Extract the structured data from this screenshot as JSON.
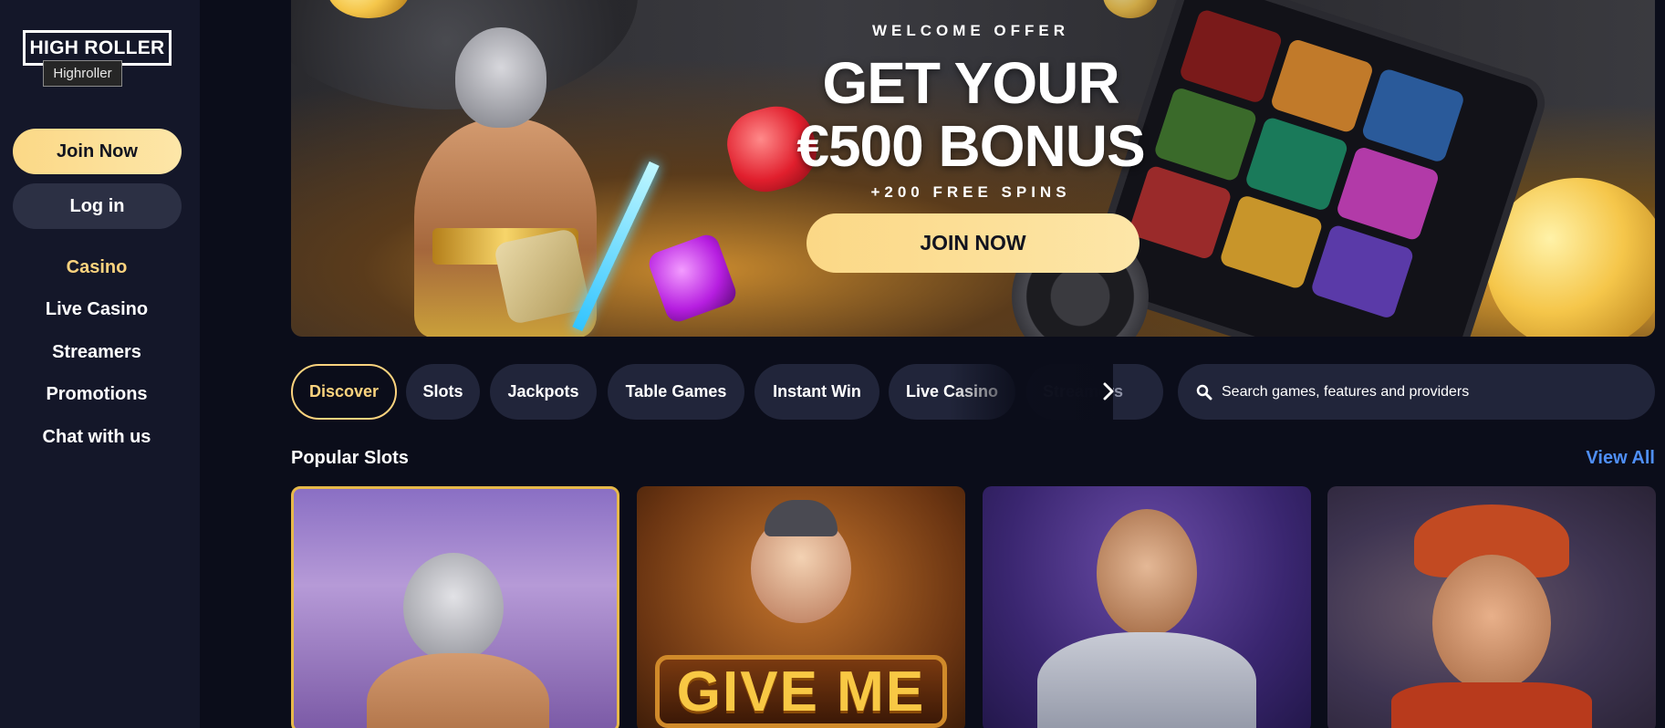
{
  "sidebar": {
    "logo_text": "HIGH ROLLER",
    "logo_tooltip": "Highroller",
    "join_label": "Join Now",
    "login_label": "Log in",
    "nav": [
      {
        "label": "Casino",
        "active": true
      },
      {
        "label": "Live Casino",
        "active": false
      },
      {
        "label": "Streamers",
        "active": false
      },
      {
        "label": "Promotions",
        "active": false
      },
      {
        "label": "Chat with us",
        "active": false
      }
    ]
  },
  "hero": {
    "kicker": "WELCOME OFFER",
    "headline_1": "GET YOUR",
    "headline_2": "€500 BONUS",
    "subline": "+200 FREE SPINS",
    "cta_label": "JOIN NOW"
  },
  "tabs": [
    {
      "label": "Discover",
      "active": true
    },
    {
      "label": "Slots"
    },
    {
      "label": "Jackpots"
    },
    {
      "label": "Table Games"
    },
    {
      "label": "Instant Win"
    },
    {
      "label": "Live Casino"
    },
    {
      "label": "Streamers"
    }
  ],
  "search": {
    "placeholder": "Search games, features and providers"
  },
  "section": {
    "title": "Popular Slots",
    "view_all_label": "View All"
  },
  "cards": [
    {
      "label": ""
    },
    {
      "label": "GIVE ME"
    },
    {
      "label": ""
    },
    {
      "label": ""
    }
  ],
  "colors": {
    "accent_gold": "#fcd37e",
    "link_blue": "#4f8ff7",
    "background": "#0b0d1a",
    "sidebar": "#141729"
  },
  "icons": {
    "search": "search-icon",
    "next": "chevron-right-icon"
  }
}
